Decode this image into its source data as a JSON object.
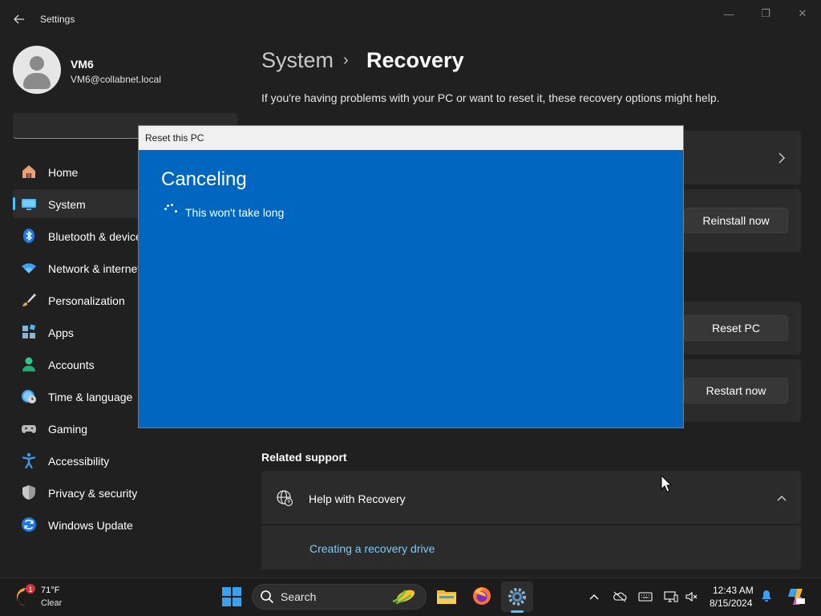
{
  "window": {
    "title": "Settings",
    "controls": {
      "minimize": "—",
      "maximize": "❐",
      "close": "✕"
    }
  },
  "user": {
    "name": "VM6",
    "email": "VM6@collabnet.local"
  },
  "search": {
    "placeholder": ""
  },
  "sidebar": {
    "items": [
      {
        "label": "Home",
        "icon": "home-icon",
        "selected": false
      },
      {
        "label": "System",
        "icon": "system-icon",
        "selected": true
      },
      {
        "label": "Bluetooth & devices",
        "icon": "bluetooth-icon",
        "selected": false
      },
      {
        "label": "Network & internet",
        "icon": "network-icon",
        "selected": false
      },
      {
        "label": "Personalization",
        "icon": "brush-icon",
        "selected": false
      },
      {
        "label": "Apps",
        "icon": "apps-icon",
        "selected": false
      },
      {
        "label": "Accounts",
        "icon": "accounts-icon",
        "selected": false
      },
      {
        "label": "Time & language",
        "icon": "clock-globe-icon",
        "selected": false
      },
      {
        "label": "Gaming",
        "icon": "gamepad-icon",
        "selected": false
      },
      {
        "label": "Accessibility",
        "icon": "accessibility-icon",
        "selected": false
      },
      {
        "label": "Privacy & security",
        "icon": "shield-icon",
        "selected": false
      },
      {
        "label": "Windows Update",
        "icon": "update-icon",
        "selected": false
      }
    ]
  },
  "main": {
    "breadcrumb": {
      "parent": "System",
      "separator": "›",
      "current": "Recovery"
    },
    "description": "If you're having problems with your PC or want to reset it, these recovery options might help.",
    "buttons": {
      "reinstall": "Reinstall now",
      "reset": "Reset PC",
      "restart": "Restart now"
    },
    "related": {
      "title": "Related support",
      "help_label": "Help with Recovery",
      "link": "Creating a recovery drive"
    }
  },
  "dialog": {
    "title": "Reset this PC",
    "heading": "Canceling",
    "subtitle": "This won't take long"
  },
  "taskbar": {
    "weather": {
      "temp": "71°F",
      "condition": "Clear",
      "badge": "1"
    },
    "search_label": "Search",
    "clock": {
      "time": "12:43 AM",
      "date": "8/15/2024"
    }
  },
  "colors": {
    "accent": "#4cc2ff",
    "dialog_blue": "#0067c0",
    "link": "#7ecbf2",
    "background": "#202020",
    "card": "#2b2b2b"
  }
}
